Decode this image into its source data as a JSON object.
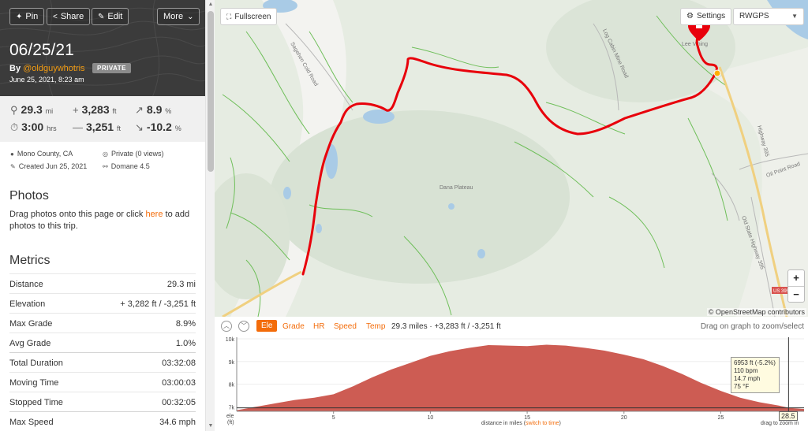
{
  "header": {
    "pin_label": "Pin",
    "share_label": "Share",
    "edit_label": "Edit",
    "more_label": "More",
    "title": "06/25/21",
    "by_label": "By",
    "username": "@oldguywhotris",
    "privacy_badge": "PRIVATE",
    "created": "June 25, 2021, 8:23 am"
  },
  "stats": {
    "distance": "29.3",
    "distance_unit": "mi",
    "duration": "3:00",
    "duration_unit": "hrs",
    "ascent": "3,283",
    "ascent_unit": "ft",
    "descent": "3,251",
    "descent_unit": "ft",
    "max_grade": "8.9",
    "max_grade_unit": "%",
    "min_grade": "-10.2",
    "min_grade_unit": "%"
  },
  "meta": {
    "location": "Mono County, CA",
    "privacy": "Private (0 views)",
    "created": "Created Jun 25, 2021",
    "bike": "Domane 4.5"
  },
  "photos": {
    "heading": "Photos",
    "text_before": "Drag photos onto this page or click ",
    "link": "here",
    "text_after": " to add photos to this trip."
  },
  "metrics": {
    "heading": "Metrics",
    "rows": [
      {
        "label": "Distance",
        "value": "29.3 mi"
      },
      {
        "label": "Elevation",
        "value": "+ 3,282 ft / -3,251 ft"
      },
      {
        "label": "Max Grade",
        "value": "8.9%"
      },
      {
        "label": "Avg Grade",
        "value": "1.0%"
      },
      {
        "label": "Total Duration",
        "value": "03:32:08"
      },
      {
        "label": "Moving Time",
        "value": "03:00:03"
      },
      {
        "label": "Stopped Time",
        "value": "00:32:05"
      },
      {
        "label": "Max Speed",
        "value": "34.6 mph"
      }
    ]
  },
  "map": {
    "fullscreen_label": "Fullscreen",
    "settings_label": "Settings",
    "layer_selected": "RWGPS",
    "zoom_in": "+",
    "zoom_out": "−",
    "attribution": "© OpenStreetMap contributors",
    "place_labels": {
      "lee_vining": "Lee Vining",
      "dana_plateau": "Dana Plateau",
      "highway_395": "Highway 395",
      "old_state_highway": "Old State Highway 395",
      "sagehen_road": "Sagehen Cold Road",
      "log_cabin_road": "Log Cabin Mine Road",
      "oil_point_road": "Oil Point Road",
      "us_shield": "US 395"
    },
    "route_color": "#e8000b"
  },
  "elevation": {
    "tabs": [
      "Ele",
      "Grade",
      "HR",
      "Speed",
      "Temp"
    ],
    "active_tab": "Ele",
    "summary": "29.3 miles · +3,283 ft / -3,251 ft",
    "drag_hint": "Drag on graph to zoom/select",
    "y_ticks": [
      "10k",
      "9k",
      "8k",
      "7k"
    ],
    "x_ticks": [
      "5",
      "10",
      "15",
      "20",
      "25"
    ],
    "y_unit_label": "ele",
    "y_unit": "(ft)",
    "x_label_before": "distance in miles (",
    "x_label_link": "switch to time",
    "x_label_after": ")",
    "drag_zoom": "drag to zoom in",
    "cursor_x": "28.5",
    "tooltip": [
      "6953 ft (-5.2%)",
      "110 bpm",
      "14.7 mph",
      "75 °F"
    ],
    "fill_color": "#cd5c53"
  },
  "chart_data": {
    "type": "area",
    "title": "",
    "xlabel": "distance in miles",
    "ylabel": "ele (ft)",
    "xlim": [
      0,
      29.3
    ],
    "ylim": [
      6800,
      10000
    ],
    "series": [
      {
        "x": [
          0,
          1,
          2,
          3,
          4,
          5,
          6,
          7,
          8,
          9,
          10,
          11,
          12,
          13,
          14,
          15,
          16,
          17,
          18,
          19,
          20,
          21,
          22,
          23,
          24,
          25,
          26,
          27,
          28,
          28.5,
          29.3
        ],
        "values": [
          6850,
          7000,
          7150,
          7300,
          7400,
          7550,
          7900,
          8300,
          8650,
          8950,
          9250,
          9450,
          9600,
          9720,
          9700,
          9680,
          9740,
          9700,
          9600,
          9480,
          9300,
          9100,
          8800,
          8450,
          8050,
          7700,
          7400,
          7200,
          7050,
          6953,
          6900
        ]
      }
    ]
  }
}
